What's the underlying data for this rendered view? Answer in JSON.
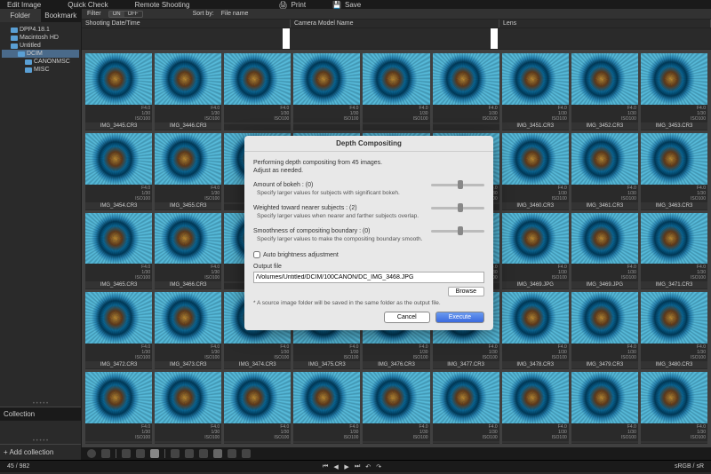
{
  "topmenu": {
    "edit": "Edit Image",
    "quick": "Quick Check",
    "remote": "Remote Shooting",
    "print": "Print",
    "save": "Save"
  },
  "sidebar": {
    "tabs": {
      "folder": "Folder",
      "bookmark": "Bookmark"
    },
    "tree": [
      {
        "label": "DPP4.18.1",
        "indent": 8,
        "sel": false
      },
      {
        "label": "Macintosh HD",
        "indent": 8,
        "sel": false
      },
      {
        "label": "Untitled",
        "indent": 8,
        "sel": false
      },
      {
        "label": "DCIM",
        "indent": 16,
        "sel": true
      },
      {
        "label": "CANONMSC",
        "indent": 24,
        "sel": false
      },
      {
        "label": "MISC",
        "indent": 24,
        "sel": false
      }
    ],
    "collection": "Collection",
    "add": "+  Add collection"
  },
  "filterbar": {
    "filter": "Filter",
    "on": "ON",
    "off": "OFF",
    "sortby": "Sort by:",
    "sortval": "File name"
  },
  "headers": {
    "c1": "Shooting Date/Time",
    "c2": "Camera Model Name",
    "c3": "Lens"
  },
  "thumb_meta": {
    "f": "F4.0",
    "sh": "1/30",
    "iso": "ISO100"
  },
  "thumbs": [
    "IMG_3445.CR3",
    "IMG_3446.CR3",
    "",
    "",
    "",
    "",
    "IMG_3451.CR3",
    "IMG_3452.CR3",
    "IMG_3453.CR3",
    "IMG_3454.CR3",
    "IMG_3455.CR3",
    "",
    "",
    "",
    "",
    "IMG_3460.CR3",
    "IMG_3461.CR3",
    "IMG_3463.CR3",
    "IMG_3465.CR3",
    "IMG_3466.CR3",
    "",
    "",
    "",
    "",
    "IMG_3469.JPG",
    "IMG_3469.JPG",
    "IMG_3471.CR3",
    "IMG_3472.CR3",
    "IMG_3473.CR3",
    "IMG_3474.CR3",
    "IMG_3475.CR3",
    "IMG_3476.CR3",
    "IMG_3477.CR3",
    "IMG_3478.CR3",
    "IMG_3479.CR3",
    "IMG_3480.CR3",
    "",
    "",
    "",
    "",
    "",
    "",
    "",
    "",
    ""
  ],
  "dialog": {
    "title": "Depth Compositing",
    "intro": "Performing depth compositing from 45 images.\nAdjust as needed.",
    "bokeh_label": "Amount of bokeh : (0)",
    "bokeh_desc": "Specify larger values for subjects with significant bokeh.",
    "weight_label": "Weighted toward nearer subjects : (2)",
    "weight_desc": "Specify larger values when nearer and farther subjects overlap.",
    "smooth_label": "Smoothness of compositing boundary : (0)",
    "smooth_desc": "Specify larger values to make the compositing boundary smooth.",
    "autobright": "Auto brightness adjustment",
    "output_label": "Output file",
    "output_path": "/Volumes/Untitled/DCIM/100CANON/DC_IMG_3468.JPG",
    "browse": "Browse",
    "note": "* A source image folder will be saved in the same folder as the output file.",
    "cancel": "Cancel",
    "execute": "Execute"
  },
  "status": {
    "left": "45 / 982",
    "right": "sRGB / sR"
  }
}
